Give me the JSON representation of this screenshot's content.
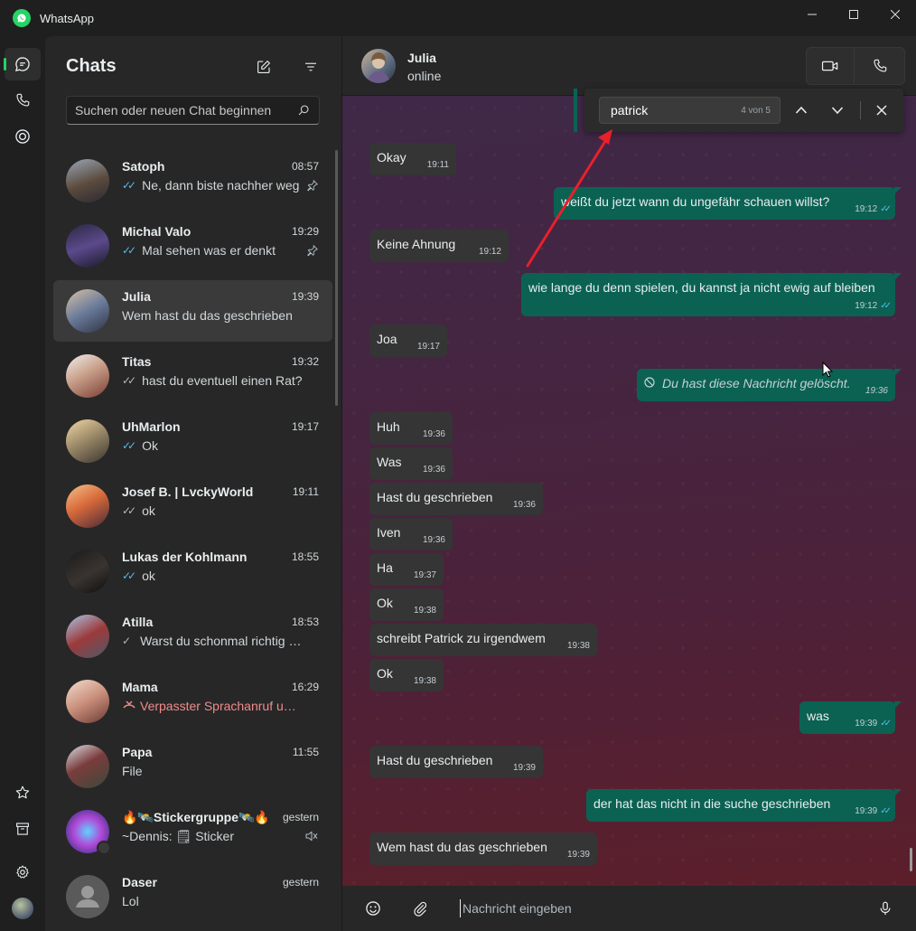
{
  "window": {
    "title": "WhatsApp"
  },
  "list": {
    "title": "Chats",
    "search_placeholder": "Suchen oder neuen Chat beginnen"
  },
  "chats": [
    {
      "name": "Satoph",
      "time": "08:57",
      "preview": "Ne, dann biste nachher weg",
      "tick": "read",
      "pinned": true
    },
    {
      "name": "Michal Valo",
      "time": "19:29",
      "preview": "Mal sehen was er denkt",
      "tick": "read",
      "pinned": true
    },
    {
      "name": "Julia",
      "time": "19:39",
      "preview": "Wem hast du das geschrieben",
      "tick": "none",
      "selected": true
    },
    {
      "name": "Titas",
      "time": "19:32",
      "preview": "hast du eventuell einen Rat?",
      "tick": "delivered"
    },
    {
      "name": "UhMarlon",
      "time": "19:17",
      "preview": "Ok",
      "tick": "read"
    },
    {
      "name": "Josef B. | LvckyWorld",
      "time": "19:11",
      "preview": "ok",
      "tick": "delivered"
    },
    {
      "name": "Lukas der Kohlmann",
      "time": "18:55",
      "preview": "ok",
      "tick": "read"
    },
    {
      "name": "Atilla",
      "time": "18:53",
      "preview": "Warst du schonmal richtig v...",
      "tick": "sent"
    },
    {
      "name": "Mama",
      "time": "16:29",
      "preview": "Verpasster Sprachanruf um...",
      "tick": "missed"
    },
    {
      "name": "Papa",
      "time": "11:55",
      "preview": "File",
      "tick": "none"
    },
    {
      "name": "🔥🛰️Stickergruppe🛰️🔥",
      "time": "gestern",
      "preview": "~Dennis: 🗒 Sticker",
      "tick": "none",
      "muted": true
    },
    {
      "name": "Daser",
      "time": "gestern",
      "preview": "Lol",
      "tick": "none"
    }
  ],
  "conversation": {
    "contact_name": "Julia",
    "contact_status": "online",
    "find": {
      "query": "patrick",
      "count": "4 von 5"
    },
    "messages": [
      {
        "dir": "in",
        "text": "Okay",
        "time": "19:11"
      },
      {
        "dir": "out",
        "text": "weißt du jetzt wann du ungefähr schauen willst?",
        "time": "19:12"
      },
      {
        "dir": "in",
        "text": "Keine Ahnung",
        "time": "19:12"
      },
      {
        "dir": "out",
        "text": "wie lange du denn spielen, du kannst ja nicht ewig auf bleiben",
        "time": "19:12"
      },
      {
        "dir": "in",
        "text": "Joa",
        "time": "19:17"
      },
      {
        "dir": "out",
        "text": "Du hast diese Nachricht gelöscht.",
        "time": "19:36",
        "deleted": true
      },
      {
        "dir": "in",
        "text": "Huh",
        "time": "19:36"
      },
      {
        "dir": "in",
        "text": "Was",
        "time": "19:36"
      },
      {
        "dir": "in",
        "text": "Hast du geschrieben",
        "time": "19:36"
      },
      {
        "dir": "in",
        "text": "Iven",
        "time": "19:36"
      },
      {
        "dir": "in",
        "text": "Ha",
        "time": "19:37"
      },
      {
        "dir": "in",
        "text": "Ok",
        "time": "19:38"
      },
      {
        "dir": "in",
        "text": "schreibt Patrick zu irgendwem",
        "time": "19:38"
      },
      {
        "dir": "in",
        "text": "Ok",
        "time": "19:38"
      },
      {
        "dir": "out",
        "text": "was",
        "time": "19:39"
      },
      {
        "dir": "in",
        "text": "Hast du geschrieben",
        "time": "19:39"
      },
      {
        "dir": "out",
        "text": "der hat das nicht in die suche geschrieben",
        "time": "19:39"
      },
      {
        "dir": "in",
        "text": "Wem hast du das geschrieben",
        "time": "19:39"
      }
    ],
    "composer_placeholder": "Nachricht eingeben"
  },
  "colors": {
    "accent": "#25d366",
    "outgoing": "#0b6253",
    "incoming": "#353535",
    "read_tick": "#53bdeb",
    "missed": "#f28b8b",
    "annotation_arrow": "#e8202a"
  }
}
